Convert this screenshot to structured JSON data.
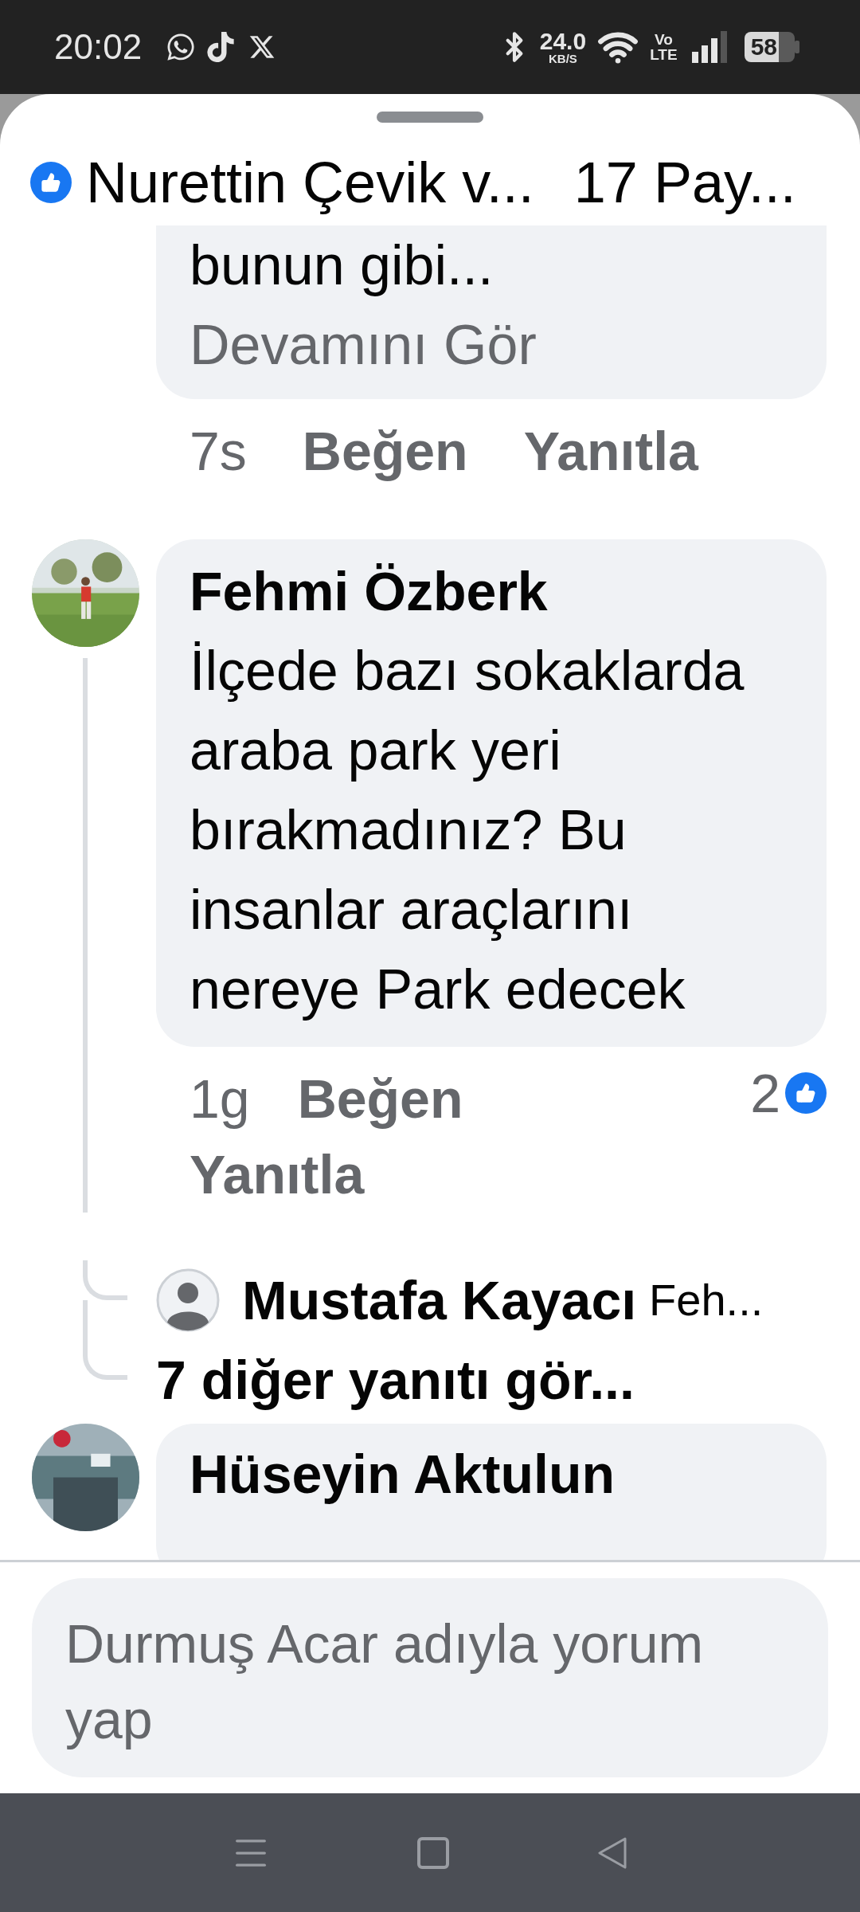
{
  "status_bar": {
    "time": "20:02",
    "net_speed": "24.0",
    "net_unit": "KB/S",
    "volte_top": "Vo",
    "volte_bottom": "LTE",
    "battery": "58"
  },
  "header": {
    "title": "Nurettin Çevik v...",
    "count": "17 Pay..."
  },
  "comments": [
    {
      "kind": "partial",
      "text": "bunun gibi...",
      "see_more": "Devamını Gör",
      "time": "7s",
      "like": "Beğen",
      "reply": "Yanıtla"
    },
    {
      "kind": "full",
      "author": "Fehmi Özberk",
      "text": "İlçede bazı sokaklarda araba park yeri bırakmadınız? Bu insanlar araçlarını nereye Park edecek",
      "time": "1g",
      "like": "Beğen",
      "reply": "Yanıtla",
      "reaction_count": "2",
      "replies": [
        {
          "author": "Mustafa Kayacı",
          "preview": "Feh..."
        }
      ],
      "more_replies": "7 diğer yanıtı gör..."
    },
    {
      "kind": "clipped",
      "author": "Hüseyin Aktulun"
    }
  ],
  "composer": {
    "placeholder": "Durmuş Acar adıyla yorum yap"
  }
}
